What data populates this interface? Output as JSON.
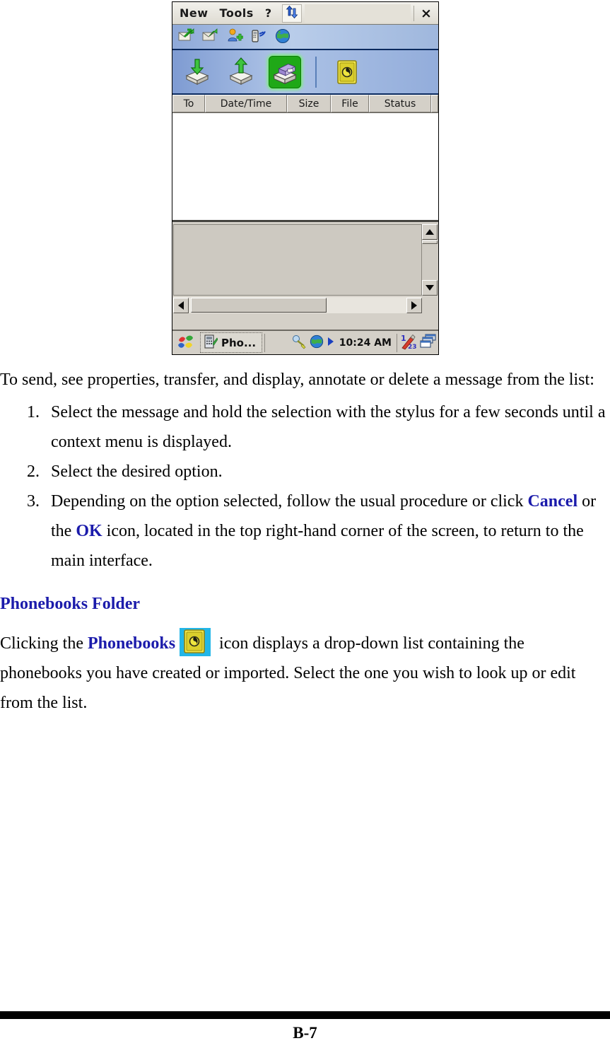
{
  "screenshot": {
    "menubar": {
      "items": [
        {
          "label": "New"
        },
        {
          "label": "Tools"
        },
        {
          "label": "?"
        }
      ],
      "sync_icon": "sync-arrows-icon",
      "close_label": "×"
    },
    "iconbar": {
      "icons": [
        {
          "name": "send-message-icon"
        },
        {
          "name": "reply-message-icon"
        },
        {
          "name": "add-contact-icon"
        },
        {
          "name": "mobile-signal-icon"
        },
        {
          "name": "globe-icon"
        }
      ]
    },
    "toolbar": {
      "buttons": [
        {
          "name": "inbox-button",
          "selected": false
        },
        {
          "name": "outbox-button",
          "selected": false
        },
        {
          "name": "archive-button",
          "selected": true
        },
        {
          "name": "phonebooks-button",
          "selected": false
        }
      ]
    },
    "columns": [
      "To",
      "Date/Time",
      "Size",
      "File",
      "Status"
    ],
    "list_rows": [],
    "taskbar": {
      "start_icon": "windows-start-icon",
      "task_label": "Pho...",
      "task_icon": "phone-app-icon",
      "tray": {
        "connection_icon": "connection-icon",
        "globe_icon": "globe-icon",
        "play_icon": "play-arrow-icon",
        "clock": "10:24 AM",
        "input_panel_icon": "input-panel-icon",
        "window-switcher_icon": "window-switcher-icon"
      }
    },
    "scrollbars": {
      "vertical_up": "scroll-up-arrow",
      "vertical_down": "scroll-down-arrow",
      "horizontal_left": "scroll-left-arrow",
      "horizontal_right": "scroll-right-arrow"
    }
  },
  "document": {
    "intro": "To send, see properties, transfer, and display, annotate or delete a message from the list:",
    "steps": [
      {
        "text_full": "Select the message and hold the selection with the stylus for a few seconds until a context menu is displayed."
      },
      {
        "text_full": "Select the desired option."
      },
      {
        "part1": "Depending on the option selected, follow the usual procedure or click ",
        "emphasis1": "Cancel",
        "part2": " or the ",
        "emphasis2": "OK",
        "part3": " icon, located in the top right-hand corner of the screen, to return to the main interface."
      }
    ],
    "heading": "Phonebooks Folder",
    "body_part1": "Clicking the ",
    "body_emphasis": "Phonebooks",
    "body_icon": "phonebooks-icon",
    "body_part2": " icon displays a drop-down list containing the phonebooks you have created or imported. Select the one you wish to look up or edit from the list."
  },
  "footer": {
    "page_number": "B-7"
  },
  "colors": {
    "accent_blue": "#1b1bab",
    "selected_green": "#1fa817",
    "titlebar_gray": "#d4d0c8",
    "toolbar_blue": "#93addb"
  }
}
